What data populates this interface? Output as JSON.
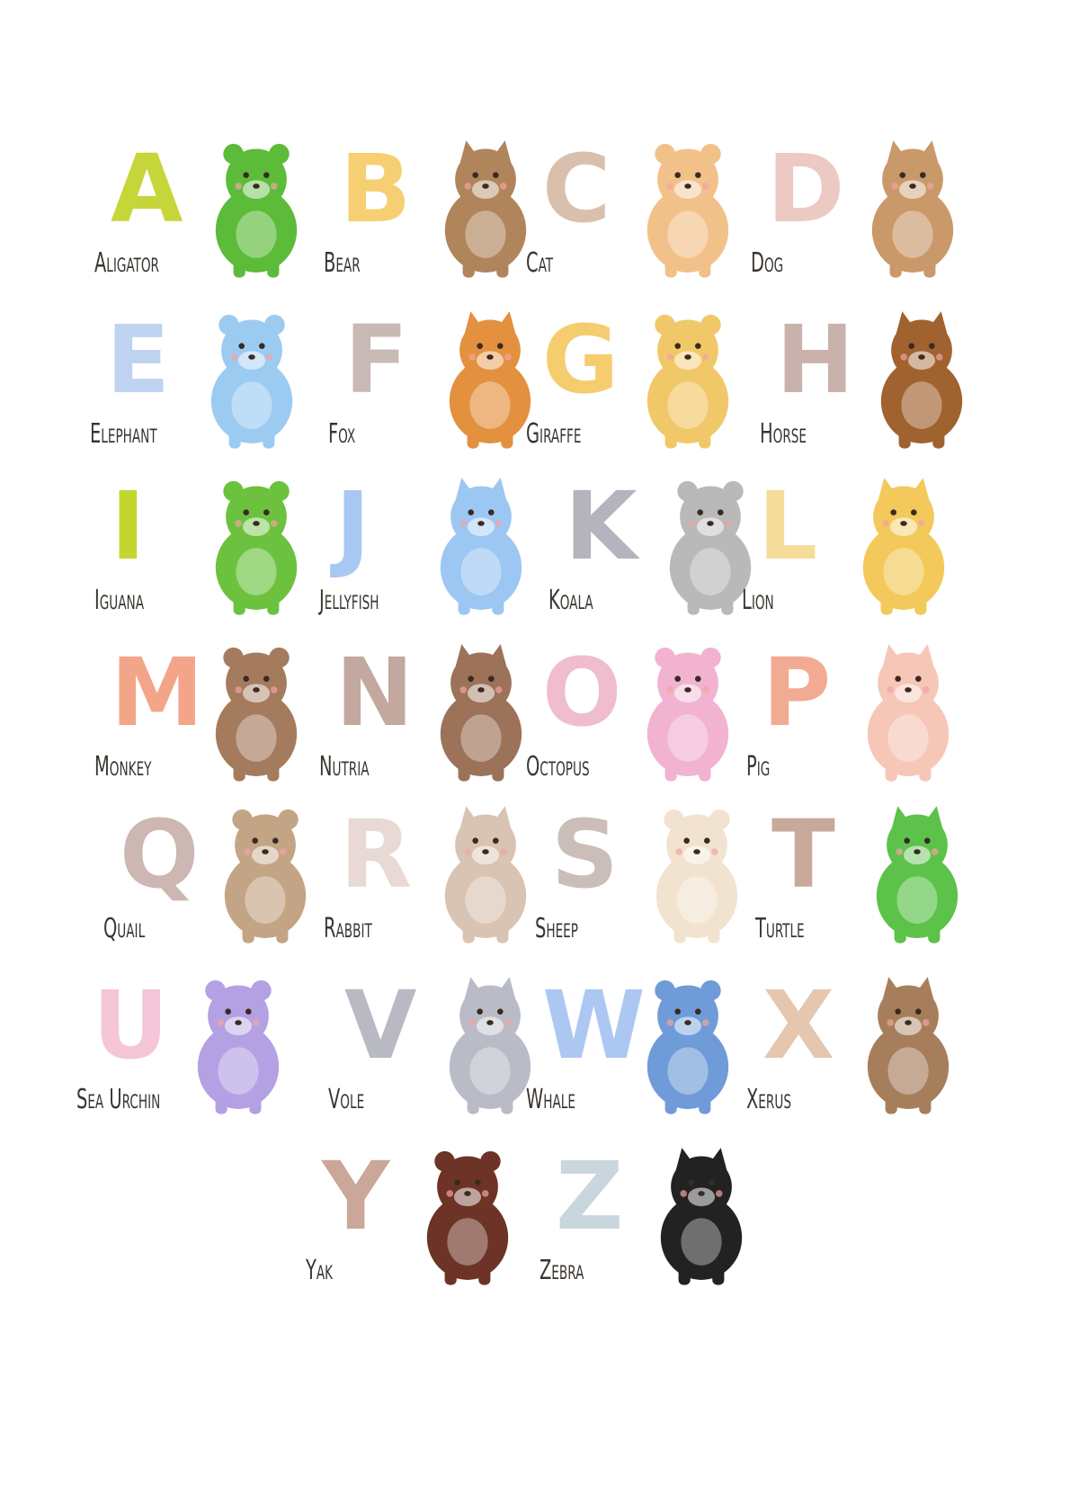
{
  "poster": {
    "entries": [
      {
        "letter": "A",
        "name": "Aligator",
        "letter_color": "#c6d63a",
        "animal": "alligator-illustration",
        "animal_color": "#5dbb3a"
      },
      {
        "letter": "B",
        "name": "Bear",
        "letter_color": "#f7cf73",
        "animal": "bear-illustration",
        "animal_color": "#b0855c"
      },
      {
        "letter": "C",
        "name": "Cat",
        "letter_color": "#d9c0ad",
        "animal": "cat-illustration",
        "animal_color": "#f2c18a"
      },
      {
        "letter": "D",
        "name": "Dog",
        "letter_color": "#ecc9c3",
        "animal": "dog-illustration",
        "animal_color": "#c9996a"
      },
      {
        "letter": "E",
        "name": "Elephant",
        "letter_color": "#bdd3f0",
        "animal": "elephant-illustration",
        "animal_color": "#9ccbf2"
      },
      {
        "letter": "F",
        "name": "Fox",
        "letter_color": "#c9b9b4",
        "animal": "fox-illustration",
        "animal_color": "#e3913f"
      },
      {
        "letter": "G",
        "name": "Giraffe",
        "letter_color": "#f6cd6e",
        "animal": "giraffe-illustration",
        "animal_color": "#f1c868"
      },
      {
        "letter": "H",
        "name": "Horse",
        "letter_color": "#c9b2ab",
        "animal": "horse-illustration",
        "animal_color": "#a0622f"
      },
      {
        "letter": "I",
        "name": "Iguana",
        "letter_color": "#c3d62f",
        "animal": "iguana-illustration",
        "animal_color": "#6cc23f"
      },
      {
        "letter": "J",
        "name": "Jellyfish",
        "letter_color": "#a9c7f3",
        "animal": "jellyfish-illustration",
        "animal_color": "#9cc7f2"
      },
      {
        "letter": "K",
        "name": "Koala",
        "letter_color": "#b5b3bd",
        "animal": "koala-illustration",
        "animal_color": "#b9b9b9"
      },
      {
        "letter": "L",
        "name": "Lion",
        "letter_color": "#f5dc9a",
        "animal": "lion-illustration",
        "animal_color": "#f2c95a"
      },
      {
        "letter": "M",
        "name": "Monkey",
        "letter_color": "#f3a58a",
        "animal": "monkey-illustration",
        "animal_color": "#a57b5e"
      },
      {
        "letter": "N",
        "name": "Nutria",
        "letter_color": "#c2a89f",
        "animal": "nutria-illustration",
        "animal_color": "#9c7259"
      },
      {
        "letter": "O",
        "name": "Octopus",
        "letter_color": "#efbcd0",
        "animal": "octopus-illustration",
        "animal_color": "#f1b3cf"
      },
      {
        "letter": "P",
        "name": "Pig",
        "letter_color": "#f3aa93",
        "animal": "pig-illustration",
        "animal_color": "#f6c6b7"
      },
      {
        "letter": "Q",
        "name": "Quail",
        "letter_color": "#cdb7b2",
        "animal": "quail-illustration",
        "animal_color": "#c3a585"
      },
      {
        "letter": "R",
        "name": "Rabbit",
        "letter_color": "#e8d9d4",
        "animal": "rabbit-illustration",
        "animal_color": "#d9c3b3"
      },
      {
        "letter": "S",
        "name": "Sheep",
        "letter_color": "#cbbdb7",
        "animal": "sheep-illustration",
        "animal_color": "#f1e3cf"
      },
      {
        "letter": "T",
        "name": "Turtle",
        "letter_color": "#c9a99c",
        "animal": "turtle-illustration",
        "animal_color": "#5cc24a"
      },
      {
        "letter": "U",
        "name": "Sea Urchin",
        "letter_color": "#f4c6d7",
        "animal": "sea-urchin-illustration",
        "animal_color": "#b3a1e3"
      },
      {
        "letter": "V",
        "name": "Vole",
        "letter_color": "#b9b9c4",
        "animal": "vole-illustration",
        "animal_color": "#b9bcc6"
      },
      {
        "letter": "W",
        "name": "Whale",
        "letter_color": "#abc7f2",
        "animal": "whale-illustration",
        "animal_color": "#6f9bd8"
      },
      {
        "letter": "X",
        "name": "Xerus",
        "letter_color": "#e5c6ae",
        "animal": "xerus-illustration",
        "animal_color": "#a77e5c"
      },
      {
        "letter": "Y",
        "name": "Yak",
        "letter_color": "#cba79a",
        "animal": "yak-illustration",
        "animal_color": "#6d3326"
      },
      {
        "letter": "Z",
        "name": "Zebra",
        "letter_color": "#c9d6dd",
        "animal": "zebra-illustration",
        "animal_color": "#222222"
      }
    ]
  }
}
